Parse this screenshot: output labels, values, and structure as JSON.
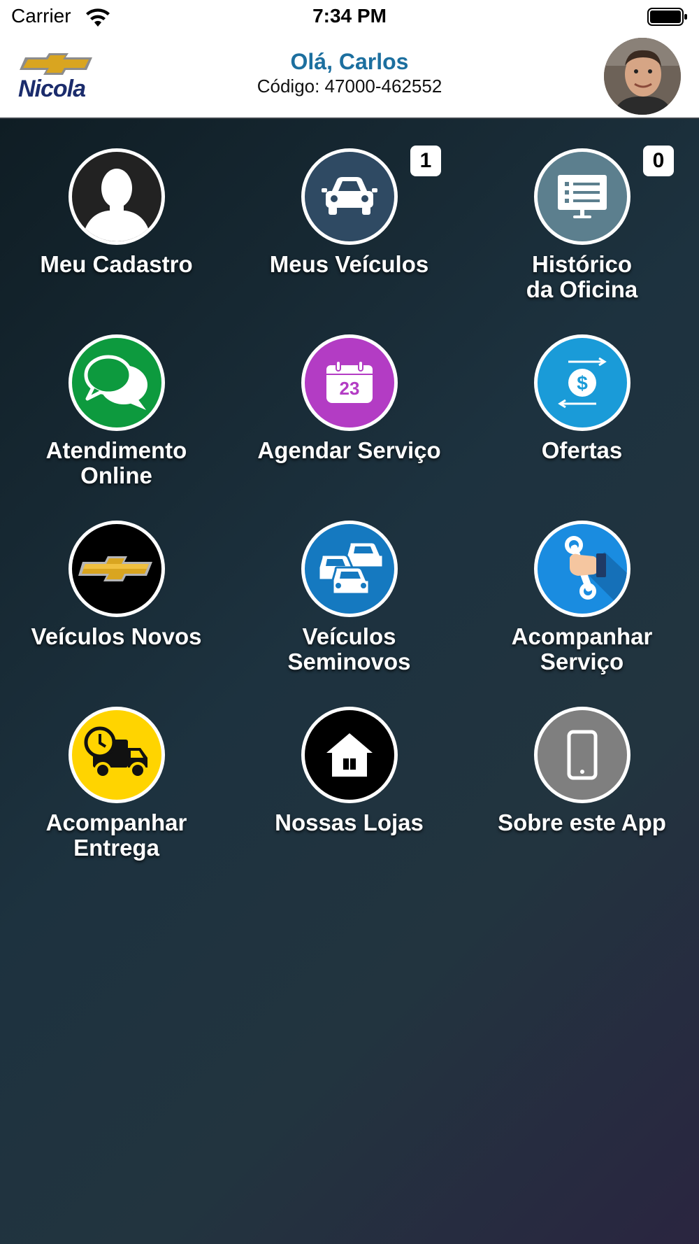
{
  "status_bar": {
    "carrier": "Carrier",
    "time": "7:34 PM"
  },
  "header": {
    "logo_text": "Nicola",
    "greeting": "Olá, Carlos",
    "code": "Código: 47000-462552"
  },
  "colors": {
    "greeting": "#1c6f9f",
    "logo_text": "#1b2c6c",
    "chevrolet_gold": "#d9a520"
  },
  "menu": [
    {
      "label": "Meu Cadastro",
      "icon": "user-silhouette-icon",
      "bg": "#222222"
    },
    {
      "label": "Meus Veículos",
      "icon": "car-icon",
      "bg": "#2f4a63",
      "badge": "1"
    },
    {
      "label": "Histórico\nda Oficina",
      "icon": "monitor-list-icon",
      "bg": "#5c7f8e",
      "badge": "0"
    },
    {
      "label": "Atendimento\nOnline",
      "icon": "chat-bubbles-icon",
      "bg": "#0d9a3e"
    },
    {
      "label": "Agendar Serviço",
      "icon": "calendar-icon",
      "bg": "#b33cc4",
      "calendar_day": "23"
    },
    {
      "label": "Ofertas",
      "icon": "dollar-exchange-icon",
      "bg": "#1a9bd8"
    },
    {
      "label": "Veículos Novos",
      "icon": "chevrolet-bowtie-icon",
      "bg": "#000000"
    },
    {
      "label": "Veículos\nSeminovos",
      "icon": "cars-stack-icon",
      "bg": "#1579c0"
    },
    {
      "label": "Acompanhar\nServiço",
      "icon": "hand-wrench-icon",
      "bg": "#1a8ce0"
    },
    {
      "label": "Acompanhar\nEntrega",
      "icon": "delivery-truck-icon",
      "bg": "#ffd400"
    },
    {
      "label": "Nossas Lojas",
      "icon": "house-icon",
      "bg": "#000000"
    },
    {
      "label": "Sobre este App",
      "icon": "smartphone-icon",
      "bg": "#7f7f7f"
    }
  ]
}
